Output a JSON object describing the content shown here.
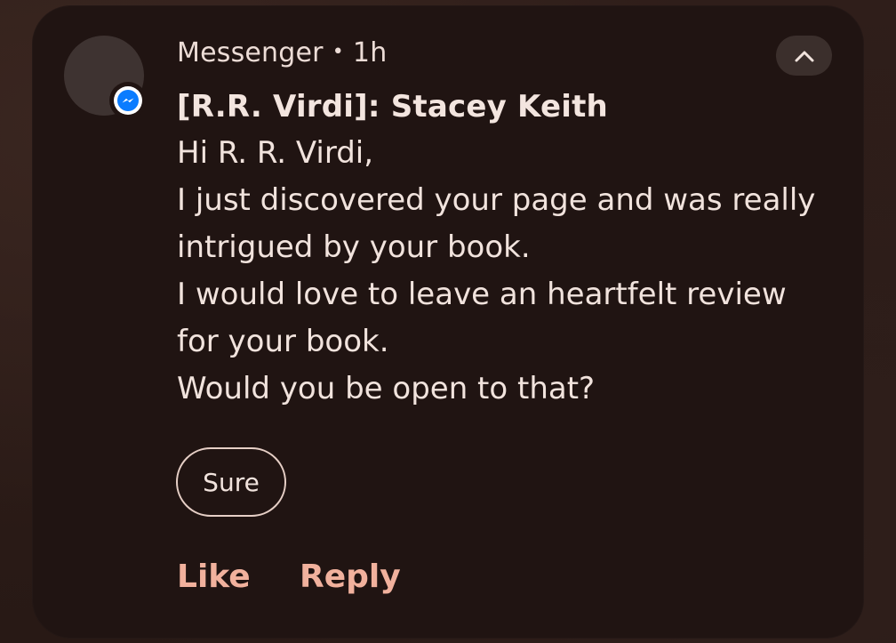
{
  "notification": {
    "app_name": "Messenger",
    "separator": "•",
    "time_ago": "1h",
    "title": "[R.R. Virdi]: Stacey Keith",
    "message_lines": [
      "Hi R. R. Virdi,",
      "I just discovered your page and was really",
      "intrigued by your book.",
      "I would love to leave an heartfelt review",
      "for your book.",
      "Would you be open to that?"
    ],
    "smart_reply": "Sure",
    "actions": {
      "like": "Like",
      "reply": "Reply"
    },
    "icons": {
      "app_badge": "messenger-icon",
      "collapse": "chevron-up-icon"
    }
  },
  "colors": {
    "card_background": "#201412",
    "accent": "#f1b19d",
    "text_primary": "#f1e3dd",
    "messenger_blue": "#0a7cff"
  }
}
